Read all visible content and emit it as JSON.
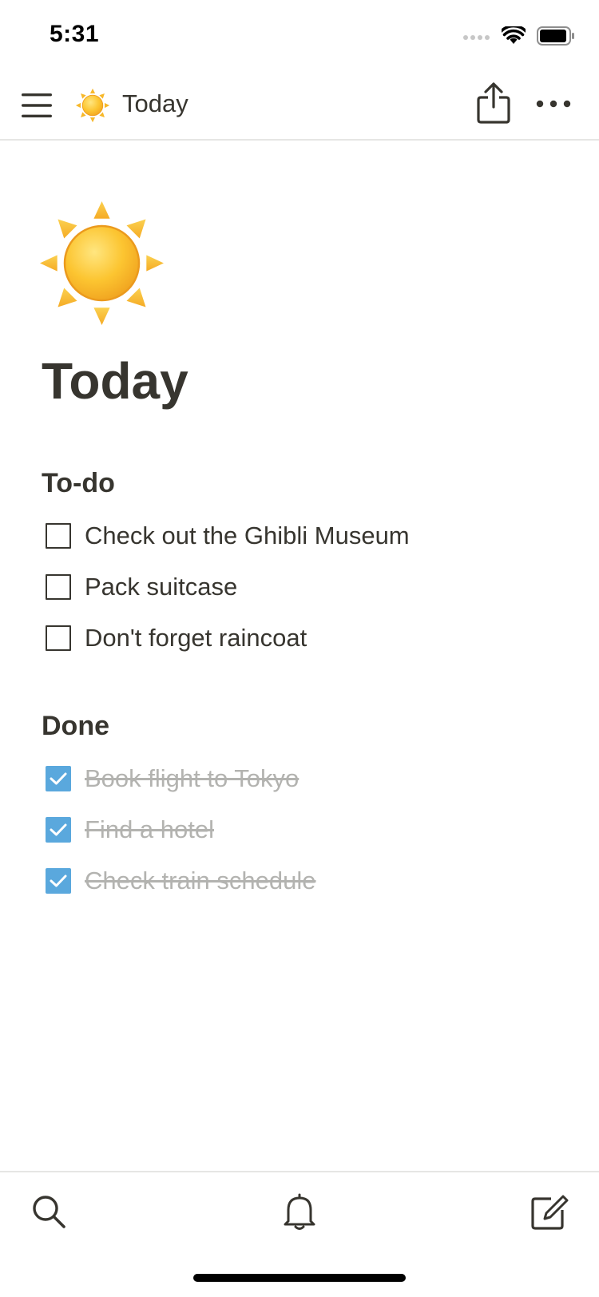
{
  "status_bar": {
    "time": "5:31"
  },
  "nav": {
    "title": "Today",
    "page_icon": "sun-icon"
  },
  "page": {
    "icon": "sun-icon",
    "title": "Today"
  },
  "sections": {
    "todo": {
      "heading": "To-do",
      "items": [
        {
          "label": "Check out the Ghibli Museum",
          "checked": false
        },
        {
          "label": "Pack suitcase",
          "checked": false
        },
        {
          "label": "Don't forget raincoat",
          "checked": false
        }
      ]
    },
    "done": {
      "heading": "Done",
      "items": [
        {
          "label": "Book flight to Tokyo",
          "checked": true
        },
        {
          "label": "Find a hotel",
          "checked": true
        },
        {
          "label": "Check train schedule",
          "checked": true
        }
      ]
    }
  },
  "toolbar": {
    "icons": [
      "search-icon",
      "bell-icon",
      "compose-icon"
    ]
  },
  "colors": {
    "text": "#37352f",
    "checked_fill": "#5aa8dd",
    "done_text": "#b3b3b0",
    "divider": "#e6e6e4"
  }
}
